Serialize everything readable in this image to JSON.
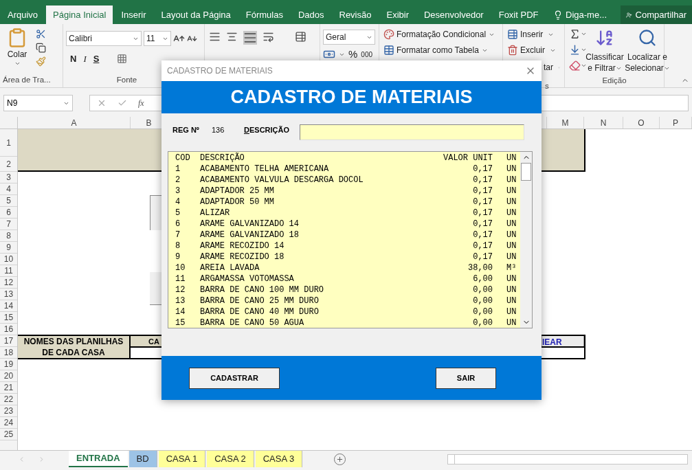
{
  "menu_tabs": [
    {
      "label": "Arquivo",
      "selected": false
    },
    {
      "label": "Página Inicial",
      "selected": true
    },
    {
      "label": "Inserir",
      "selected": false
    },
    {
      "label": "Layout da Página",
      "selected": false
    },
    {
      "label": "Fórmulas",
      "selected": false
    },
    {
      "label": "Dados",
      "selected": false
    },
    {
      "label": "Revisão",
      "selected": false
    },
    {
      "label": "Exibir",
      "selected": false
    },
    {
      "label": "Desenvolvedor",
      "selected": false
    },
    {
      "label": "Foxit PDF",
      "selected": false
    }
  ],
  "tell_me": "Diga-me...",
  "share": "Compartilhar",
  "ribbon": {
    "clipboard": {
      "paste": "Colar",
      "group": "Área de Tra..."
    },
    "font": {
      "name": "Calibri",
      "size": "11",
      "bold": "N",
      "italic": "I",
      "underline": "S",
      "group": "Fonte"
    },
    "number": {
      "format": "Geral",
      "percent": "%",
      "thousands": "000"
    },
    "styles": [
      "Formatação Condicional",
      "Formatar como Tabela"
    ],
    "cells": {
      "items": [
        "Inserir",
        "Excluir",
        "tar"
      ],
      "group": "s"
    },
    "editing": {
      "sort": [
        "Classificar",
        "e Filtrar"
      ],
      "find": [
        "Localizar e",
        "Selecionar"
      ],
      "group": "Edição"
    }
  },
  "formula_bar": {
    "name_box": "N9",
    "fx": "fx"
  },
  "sheet": {
    "columns": [
      "A",
      "B",
      "M",
      "N",
      "O",
      "P"
    ],
    "rows": [
      "1",
      "2",
      "3",
      "4",
      "5",
      "6",
      "7",
      "8",
      "9",
      "10",
      "11",
      "12",
      "13",
      "14",
      "15",
      "16",
      "17",
      "18",
      "19",
      "20",
      "21",
      "22",
      "23",
      "24",
      "25"
    ],
    "names_header": [
      "NOMES DAS PLANILHAS",
      "DE CADA CASA"
    ],
    "column_c_header": "CA",
    "right_header": "IEAR"
  },
  "sheet_tabs": [
    {
      "label": "ENTRADA",
      "selected": true
    },
    {
      "label": "BD",
      "selected": false,
      "color": "#9dc3e6"
    },
    {
      "label": "CASA 1",
      "selected": false,
      "color": "#ffff99"
    },
    {
      "label": "CASA 2",
      "selected": false,
      "color": "#ffff99"
    },
    {
      "label": "CASA 3",
      "selected": false,
      "color": "#ffff99"
    }
  ],
  "dialog": {
    "title": "CADASTRO DE MATERIAIS",
    "heading": "CADASTRO DE MATERIAIS",
    "reg_label": "REG Nº",
    "reg_value": "136",
    "description_label": "DESCRIÇÃO",
    "list_header": {
      "cod": "COD",
      "desc": "DESCRIÇÃO",
      "value": "VALOR UNIT",
      "unit": "UN"
    },
    "items": [
      {
        "cod": "1",
        "desc": "ACABAMENTO TELHA AMERICANA",
        "value": "0,17",
        "unit": "UN"
      },
      {
        "cod": "2",
        "desc": "ACABAMENTO VALVULA DESCARGA DOCOL",
        "value": "0,17",
        "unit": "UN"
      },
      {
        "cod": "3",
        "desc": "ADAPTADOR 25 MM",
        "value": "0,17",
        "unit": "UN"
      },
      {
        "cod": "4",
        "desc": "ADAPTADOR 50 MM",
        "value": "0,17",
        "unit": "UN"
      },
      {
        "cod": "5",
        "desc": "ALIZAR",
        "value": "0,17",
        "unit": "UN"
      },
      {
        "cod": "6",
        "desc": "ARAME GALVANIZADO 14",
        "value": "0,17",
        "unit": "UN"
      },
      {
        "cod": "7",
        "desc": "ARAME GALVANIZADO 18",
        "value": "0,17",
        "unit": "UN"
      },
      {
        "cod": "8",
        "desc": "ARAME RECOZIDO 14",
        "value": "0,17",
        "unit": "UN"
      },
      {
        "cod": "9",
        "desc": "ARAME RECOZIDO 18",
        "value": "0,17",
        "unit": "UN"
      },
      {
        "cod": "10",
        "desc": "AREIA LAVADA",
        "value": "38,00",
        "unit": "M³"
      },
      {
        "cod": "11",
        "desc": "ARGAMASSA VOTOMASSA",
        "value": "6,00",
        "unit": "UN"
      },
      {
        "cod": "12",
        "desc": "BARRA DE CANO 100 MM DURO",
        "value": "0,00",
        "unit": "UN"
      },
      {
        "cod": "13",
        "desc": "BARRA DE CANO 25 MM DURO",
        "value": "0,00",
        "unit": "UN"
      },
      {
        "cod": "14",
        "desc": "BARRA DE CANO 40 MM DURO",
        "value": "0,00",
        "unit": "UN"
      },
      {
        "cod": "15",
        "desc": "BARRA DE CANO 50 AGUA",
        "value": "0,00",
        "unit": "UN"
      }
    ],
    "buttons": [
      "CADASTRAR",
      "SAIR"
    ]
  }
}
